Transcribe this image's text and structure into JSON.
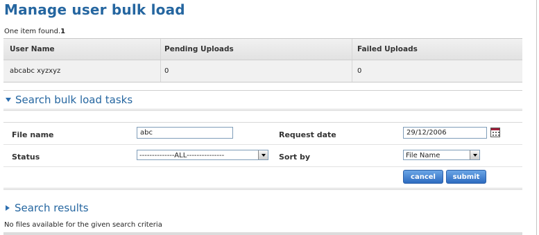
{
  "page_title": "Manage user bulk load",
  "count_text": "One item found.",
  "count_value": "1",
  "summary": {
    "headers": [
      "User Name",
      "Pending Uploads",
      "Failed Uploads"
    ],
    "rows": [
      [
        "abcabc xyzxyz",
        "0",
        "0"
      ]
    ]
  },
  "search_section": {
    "title": "Search bulk load tasks",
    "fields": {
      "file_name_label": "File name",
      "file_name_value": "abc",
      "request_date_label": "Request date",
      "request_date_value": "29/12/2006",
      "status_label": "Status",
      "status_value": "--------------ALL---------------",
      "sort_by_label": "Sort by",
      "sort_by_value": "File Name"
    },
    "buttons": {
      "cancel": "cancel",
      "submit": "submit"
    }
  },
  "results_section": {
    "title": "Search results",
    "empty_message": "No files available for the given search criteria"
  },
  "colors": {
    "accent": "#2566a0",
    "button": "#3b7dd0"
  }
}
